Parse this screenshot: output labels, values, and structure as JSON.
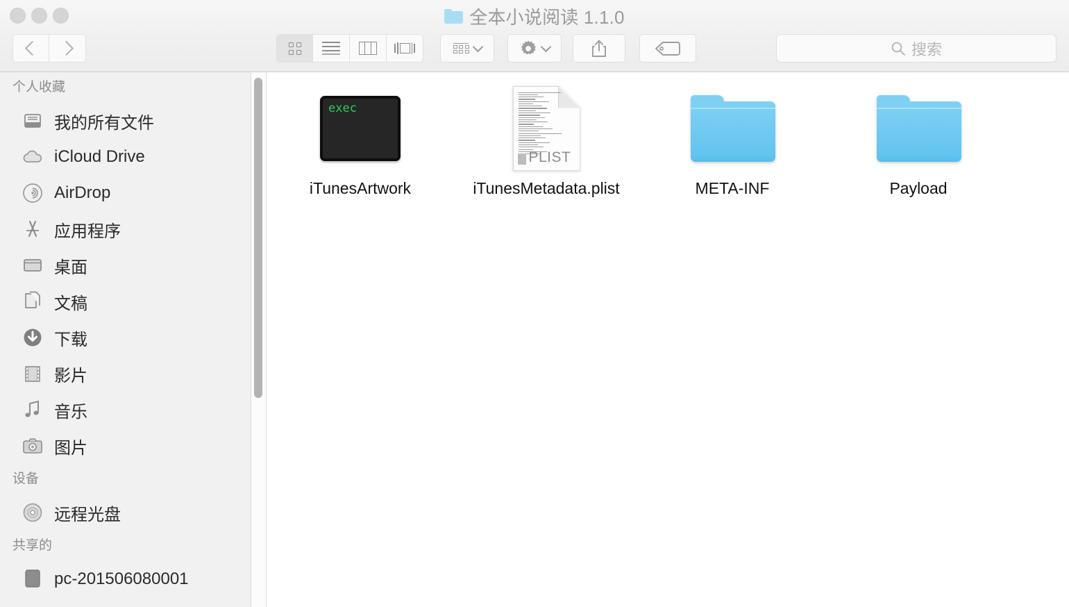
{
  "window": {
    "title": "全本小说阅读 1.1.0",
    "title_icon": "folder-icon",
    "traffic_lights": [
      "close-button",
      "minimize-button",
      "zoom-button"
    ]
  },
  "toolbar": {
    "back_label": "‹",
    "forward_label": "›",
    "view_modes": [
      {
        "name": "icon-view",
        "icon": "grid-icon",
        "active": true
      },
      {
        "name": "list-view",
        "icon": "list-icon",
        "active": false
      },
      {
        "name": "column-view",
        "icon": "columns-icon",
        "active": false
      },
      {
        "name": "coverflow-view",
        "icon": "coverflow-icon",
        "active": false
      }
    ],
    "arrange_icon": "arrange-grid-icon",
    "action_icon": "gear-icon",
    "share_icon": "share-icon",
    "tag_icon": "tag-icon",
    "search": {
      "placeholder": "搜索",
      "icon": "search-icon",
      "value": ""
    }
  },
  "sidebar": {
    "sections": [
      {
        "title": "个人收藏",
        "items": [
          {
            "label": "我的所有文件",
            "icon": "all-files-icon"
          },
          {
            "label": "iCloud Drive",
            "icon": "cloud-icon"
          },
          {
            "label": "AirDrop",
            "icon": "airdrop-icon"
          },
          {
            "label": "应用程序",
            "icon": "applications-icon"
          },
          {
            "label": "桌面",
            "icon": "desktop-icon"
          },
          {
            "label": "文稿",
            "icon": "documents-icon"
          },
          {
            "label": "下载",
            "icon": "downloads-icon"
          },
          {
            "label": "影片",
            "icon": "movies-icon"
          },
          {
            "label": "音乐",
            "icon": "music-icon"
          },
          {
            "label": "图片",
            "icon": "pictures-icon"
          }
        ]
      },
      {
        "title": "设备",
        "items": [
          {
            "label": "远程光盘",
            "icon": "disc-icon"
          }
        ]
      },
      {
        "title": "共享的",
        "items": [
          {
            "label": "pc-201506080001",
            "icon": "computer-icon"
          }
        ]
      }
    ]
  },
  "content": {
    "files": [
      {
        "name": "iTunesArtwork",
        "kind": "executable",
        "icon": "exec-icon",
        "badge_text": "exec"
      },
      {
        "name": "iTunesMetadata.plist",
        "kind": "plist-document",
        "icon": "plist-document-icon",
        "badge_text": "PLIST"
      },
      {
        "name": "META-INF",
        "kind": "folder",
        "icon": "folder-icon",
        "badge_text": ""
      },
      {
        "name": "Payload",
        "kind": "folder",
        "icon": "folder-icon",
        "badge_text": ""
      }
    ]
  },
  "colors": {
    "folder_blue": "#6ec9f2",
    "title_folder_blue": "#a8dcf4",
    "exec_green": "#2ecc5e",
    "sidebar_bg": "#f1f1f1",
    "toolbar_bg": "#f1f1f1",
    "content_bg": "#ffffff"
  }
}
